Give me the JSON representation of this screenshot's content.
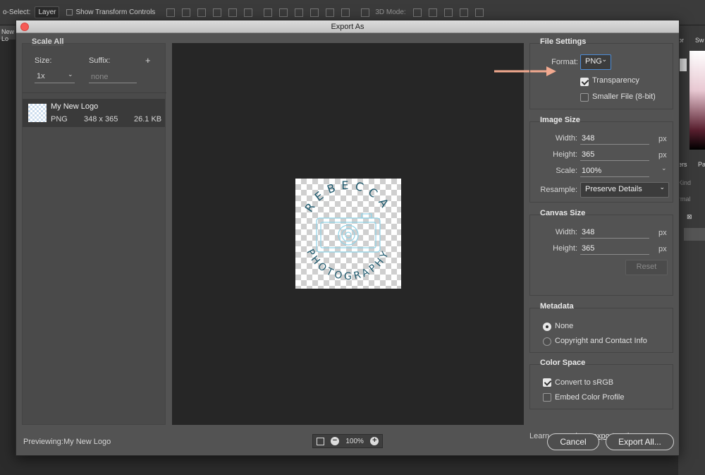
{
  "ps": {
    "auto_select_label": "o-Select:",
    "auto_select_value": "Layer",
    "transform_controls_label": "Show Transform Controls",
    "mode_label": "3D Mode:",
    "left_tab": "New Lo",
    "right_tab1": "or",
    "right_tab2": "Sw",
    "right_tab3": "ers",
    "right_tab4": "Pa",
    "right_kind": "Kind",
    "right_normal": "rmal"
  },
  "dialog": {
    "title": "Export As",
    "left": {
      "scale_all_title": "Scale All",
      "size_label": "Size:",
      "suffix_label": "Suffix:",
      "add_symbol": "+",
      "size_value": "1x",
      "suffix_placeholder": "none",
      "asset": {
        "name": "My New Logo",
        "format": "PNG",
        "dimensions": "348 x 365",
        "filesize": "26.1 KB"
      }
    },
    "preview": {
      "logo_top_text": "REBECCA",
      "logo_bottom_text": "PHOTOGRAPHY"
    },
    "file_settings": {
      "title": "File Settings",
      "format_label": "Format:",
      "format_value": "PNG",
      "transparency_label": "Transparency",
      "transparency_checked": true,
      "smaller_file_label": "Smaller File (8-bit)",
      "smaller_file_checked": false
    },
    "image_size": {
      "title": "Image Size",
      "width_label": "Width:",
      "width_value": "348",
      "height_label": "Height:",
      "height_value": "365",
      "scale_label": "Scale:",
      "scale_value": "100%",
      "resample_label": "Resample:",
      "resample_value": "Preserve Details",
      "unit": "px"
    },
    "canvas_size": {
      "title": "Canvas Size",
      "width_label": "Width:",
      "width_value": "348",
      "height_label": "Height:",
      "height_value": "365",
      "unit": "px",
      "reset_label": "Reset"
    },
    "metadata": {
      "title": "Metadata",
      "option_none": "None",
      "option_copyright": "Copyright and Contact Info",
      "selected": "None"
    },
    "color_space": {
      "title": "Color Space",
      "convert_label": "Convert to sRGB",
      "convert_checked": true,
      "embed_label": "Embed Color Profile",
      "embed_checked": false
    },
    "learn_more_prefix": "Learn more about",
    "learn_more_link": "export options.",
    "footer": {
      "previewing_label": "Previewing:",
      "previewing_value": "My New Logo",
      "zoom_value": "100%",
      "cancel_label": "Cancel",
      "export_label": "Export All..."
    }
  },
  "colors": {
    "arrow": "#f2a98f",
    "logo_text": "#1f5a6e",
    "logo_camera": "#8fd3e8",
    "close_button": "#f65a55"
  }
}
